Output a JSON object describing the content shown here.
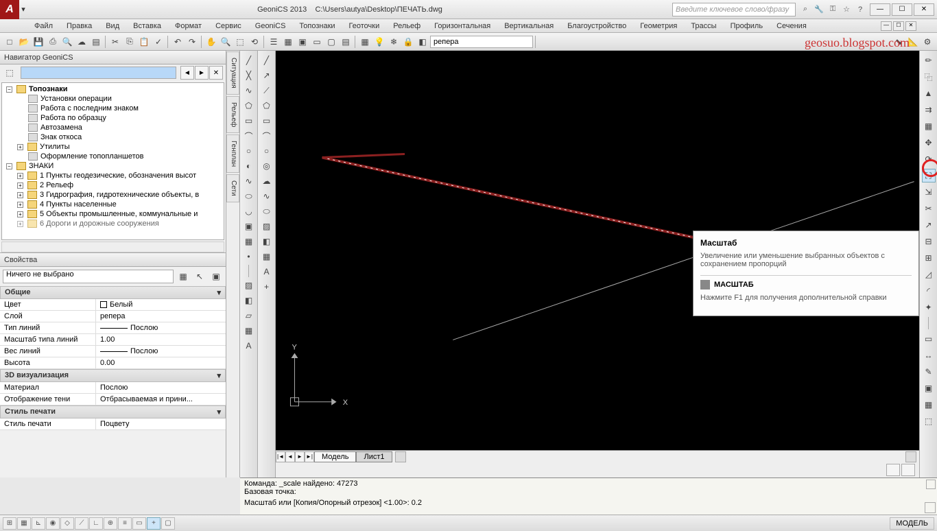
{
  "title": {
    "app": "GeoniCS 2013",
    "file": "C:\\Users\\autya\\Desktop\\ПЕЧАТЬ.dwg"
  },
  "search": {
    "placeholder": "Введите ключевое слово/фразу"
  },
  "watermark": "geosuo.blogspot.com",
  "menu": [
    "Файл",
    "Правка",
    "Вид",
    "Вставка",
    "Формат",
    "Сервис",
    "GeoniCS",
    "Топознаки",
    "Геоточки",
    "Рельеф",
    "Горизонтальная",
    "Вертикальная",
    "Благоустройство",
    "Геометрия",
    "Трассы",
    "Профиль",
    "Сечения"
  ],
  "layer": "репера",
  "nav": {
    "title": "Навигатор GeoniCS",
    "root": "Топознаки",
    "items_a": [
      "Установки операции",
      "Работа с последним знаком",
      "Работа по образцу",
      "Автозамена",
      "Знак откоса"
    ],
    "items_b": [
      "Утилиты",
      "Оформление топопланшетов"
    ],
    "znaki": "ЗНАКИ",
    "items_c": [
      "1 Пункты геодезические, обозначения высот",
      "2 Рельеф",
      "3 Гидрография, гидротехнические объекты, в",
      "4 Пункты населенные",
      "5 Объекты промышленные, коммунальные и",
      "6 Дороги и дорожные сооружения"
    ]
  },
  "vtabs": [
    "Ситуация",
    "Рельеф",
    "Генплан",
    "Сети"
  ],
  "props": {
    "title": "Свойства",
    "selection": "Ничего не выбрано",
    "sections": {
      "general": "Общие",
      "viz3d": "3D визуализация",
      "printstyle": "Стиль печати"
    },
    "rows": {
      "color_l": "Цвет",
      "color_v": "Белый",
      "layer_l": "Слой",
      "layer_v": "репера",
      "ltype_l": "Тип линий",
      "ltype_v": "Послою",
      "ltscale_l": "Масштаб типа линий",
      "ltscale_v": "1.00",
      "lweight_l": "Вес линий",
      "lweight_v": "Послою",
      "height_l": "Высота",
      "height_v": "0.00",
      "material_l": "Материал",
      "material_v": "Послою",
      "shadow_l": "Отображение тени",
      "shadow_v": "Отбрасываемая и прини...",
      "pstyle_l": "Стиль печати",
      "pstyle_v": "Поцвету"
    }
  },
  "tooltip": {
    "title": "Масштаб",
    "desc": "Увеличение или уменьшение выбранных объектов с сохранением пропорций",
    "cmd": "МАСШТАБ",
    "help": "Нажмите F1 для получения дополнительной справки"
  },
  "tabs": {
    "model": "Модель",
    "sheet": "Лист1"
  },
  "axis": {
    "x": "X",
    "y": "Y"
  },
  "command": {
    "l1": "Команда: _scale найдено: 47273",
    "l2": "Базовая точка:",
    "l3": "Масштаб или  [Копия/Опорный отрезок] <1.00>: 0.2"
  },
  "status": {
    "model": "МОДЕЛЬ"
  }
}
